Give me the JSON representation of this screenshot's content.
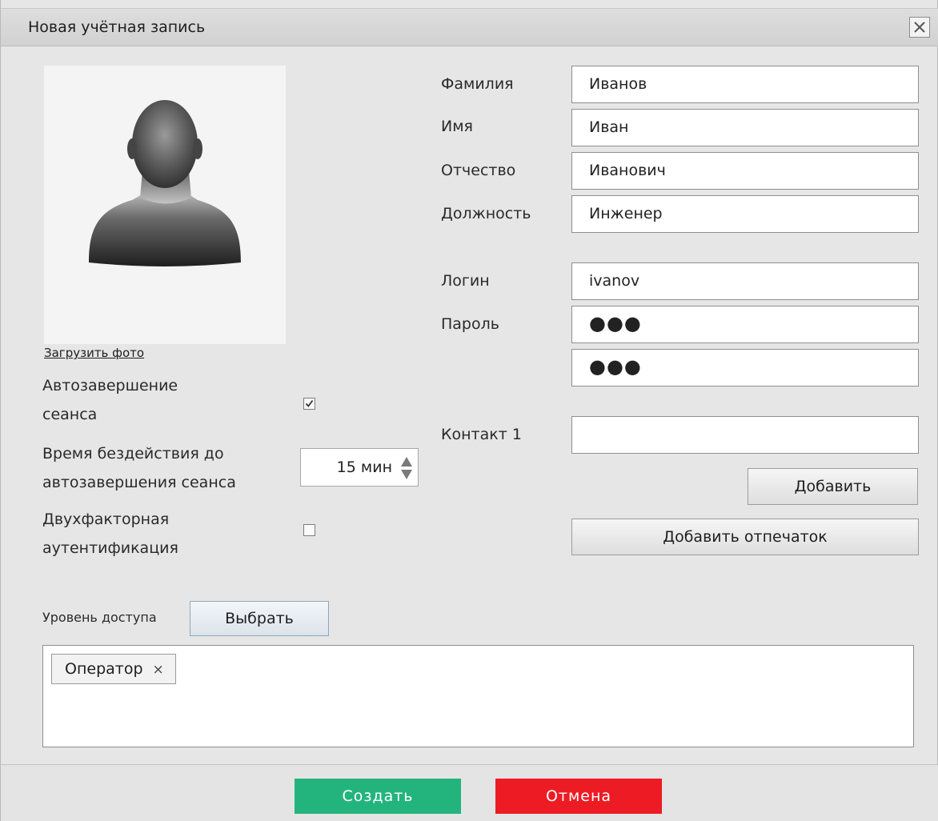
{
  "window": {
    "title": "Новая учётная запись",
    "close_icon": "close-icon"
  },
  "photo": {
    "upload_label": "Загрузить фото",
    "icon": "user-silhouette-icon"
  },
  "options": {
    "auto_logout_label": "Автозавершение сеанса",
    "auto_logout_line1": "Автозавершение",
    "auto_logout_line2": "сеанса",
    "auto_logout_checked": true,
    "idle_time_line1": "Время бездействия до",
    "idle_time_line2": "автозавершения сеанса",
    "idle_time_value": "15 мин",
    "two_factor_line1": "Двухфакторная",
    "two_factor_line2": "аутентификация",
    "two_factor_checked": false
  },
  "form": {
    "last_name": {
      "label": "Фамилия",
      "value": "Иванов"
    },
    "first_name": {
      "label": "Имя",
      "value": "Иван"
    },
    "patronymic": {
      "label": "Отчество",
      "value": "Иванович"
    },
    "position": {
      "label": "Должность",
      "value": "Инженер"
    },
    "login": {
      "label": "Логин",
      "value": "ivanov"
    },
    "password": {
      "label": "Пароль",
      "value": "●●●",
      "confirm_value": "●●●"
    },
    "contact": {
      "label": "Контакт 1",
      "value": ""
    },
    "add_button": "Добавить",
    "add_fingerprint_button": "Добавить отпечаток"
  },
  "access": {
    "label": "Уровень доступа",
    "select_button": "Выбрать",
    "chips": [
      {
        "label": "Оператор",
        "remove": "×"
      }
    ]
  },
  "footer": {
    "create_label": "Создать",
    "cancel_label": "Отмена",
    "create_color": "#23b47e",
    "cancel_color": "#ed1c24"
  }
}
